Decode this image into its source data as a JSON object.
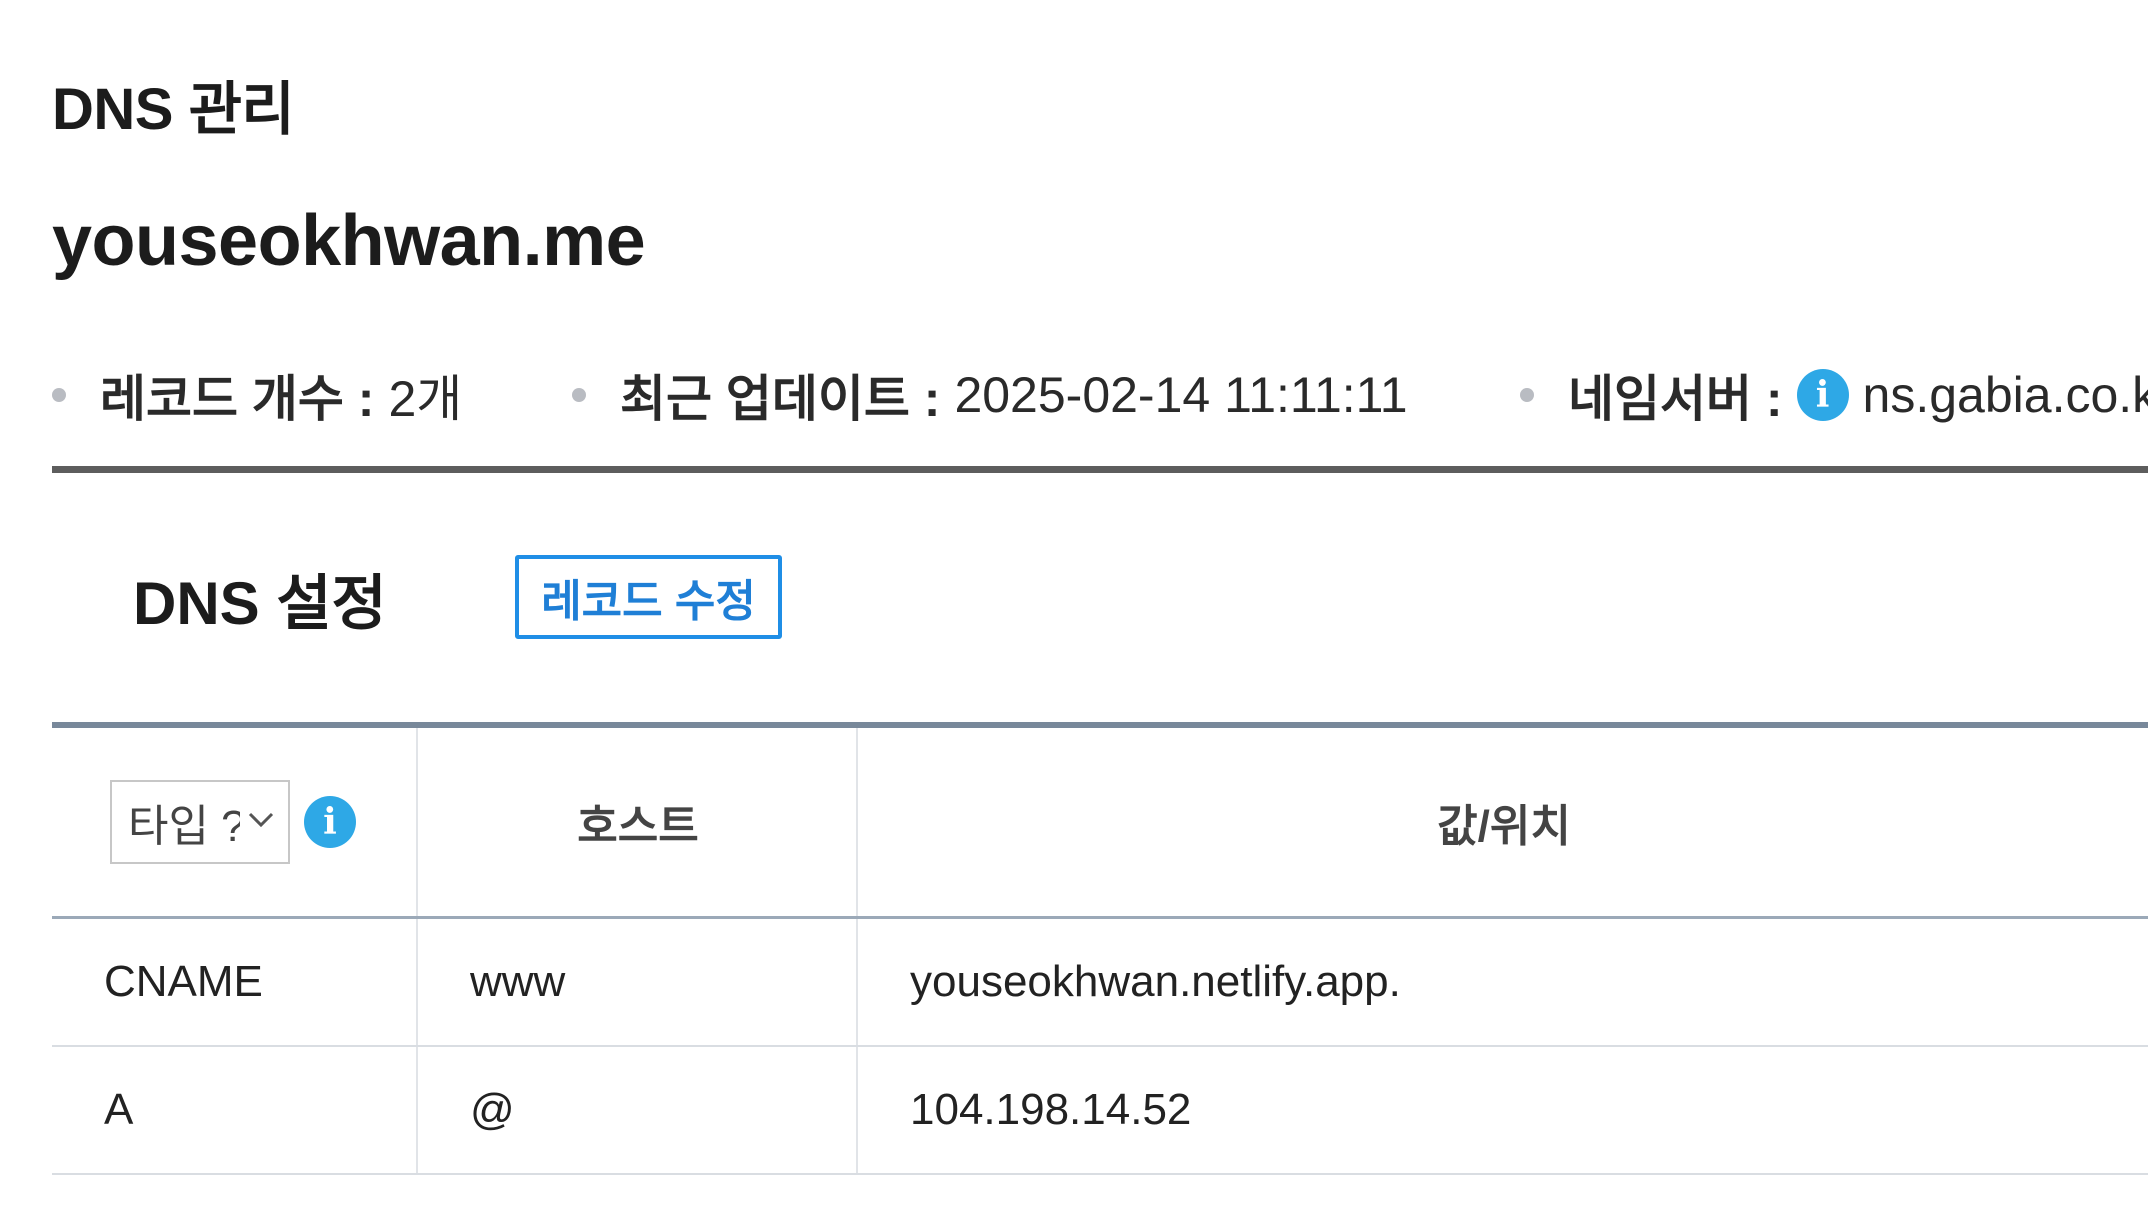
{
  "page": {
    "section_title": "DNS 관리",
    "domain": "youseokhwan.me"
  },
  "meta": {
    "record_count_label": "레코드 개수 :",
    "record_count_value": "2개",
    "last_update_label": "최근 업데이트 :",
    "last_update_value": "2025-02-14 11:11:11",
    "nameserver_label": "네임서버 :",
    "nameserver_icon": "info-icon",
    "nameserver_value": "ns.gabia.co.k"
  },
  "dns_setting": {
    "title": "DNS 설정",
    "edit_button_label": "레코드 수정"
  },
  "table": {
    "type_select_value": "타입 ?",
    "type_info_icon": "info-icon",
    "headers": {
      "host": "호스트",
      "value": "값/위치"
    },
    "rows": [
      {
        "type": "CNAME",
        "host": "www",
        "value": "youseokhwan.netlify.app."
      },
      {
        "type": "A",
        "host": "@",
        "value": "104.198.14.52"
      }
    ]
  },
  "colors": {
    "accent": "#1f8ee6",
    "info_icon": "#2ea8e6"
  }
}
